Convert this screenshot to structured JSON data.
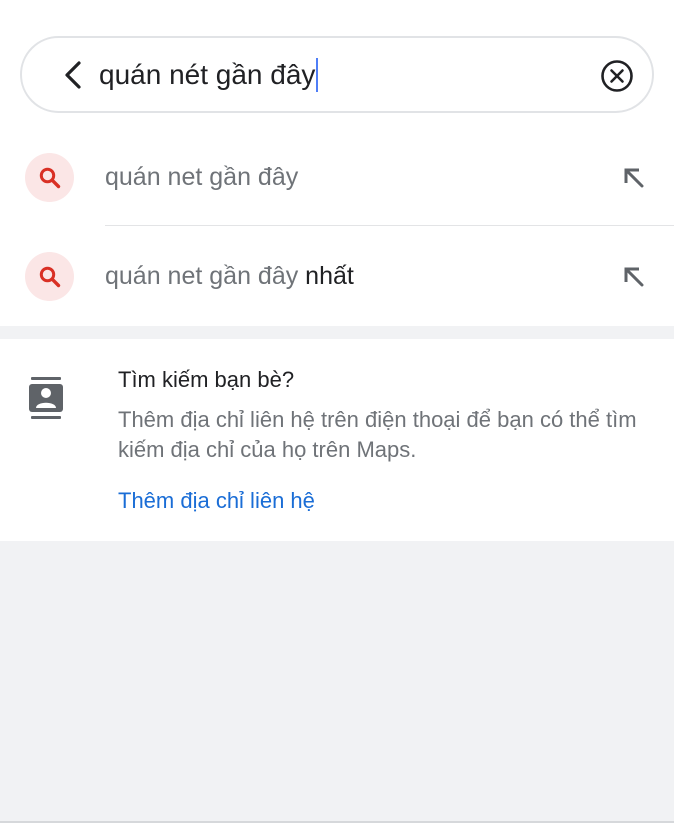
{
  "search": {
    "query": "quán nét gần đây"
  },
  "suggestions": [
    {
      "text": "quán net gần đây",
      "bold_suffix": ""
    },
    {
      "text": "quán net gần đây ",
      "bold_suffix": "nhất"
    }
  ],
  "contacts_card": {
    "title": "Tìm kiếm bạn bè?",
    "description": "Thêm địa chỉ liên hệ trên điện thoại để bạn có thể tìm kiếm địa chỉ của họ trên Maps.",
    "link_label": "Thêm địa chỉ liên hệ"
  },
  "icons": {
    "back": "chevron-left-icon",
    "clear": "clear-circle-icon",
    "suggestion": "search-icon",
    "fill_query": "arrow-up-left-icon",
    "contacts": "contact-book-icon"
  },
  "colors": {
    "accent_link": "#1a6dd6",
    "search_icon_red": "#d93025",
    "search_icon_bg": "#fbe6e6",
    "caret": "#4f7ef7"
  }
}
